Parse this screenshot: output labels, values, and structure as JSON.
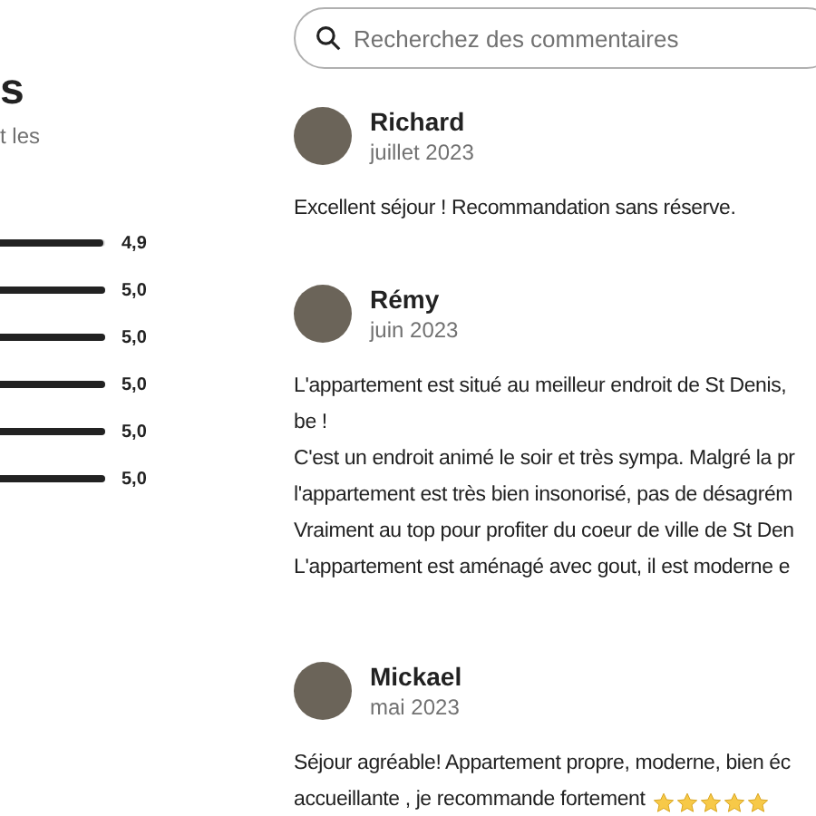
{
  "summary": {
    "heading": "s",
    "subtitle": "t les",
    "ratings": [
      {
        "level": 0.98,
        "value": "4,9"
      },
      {
        "level": 1,
        "value": "5,0"
      },
      {
        "level": 1,
        "value": "5,0"
      },
      {
        "level": 1,
        "value": "5,0"
      },
      {
        "level": 1,
        "value": "5,0"
      },
      {
        "level": 1,
        "value": "5,0"
      }
    ]
  },
  "search": {
    "placeholder": "Recherchez des commentaires"
  },
  "reviews": [
    {
      "name": "Richard",
      "date": "juillet 2023",
      "lines": [
        "Excellent séjour ! Recommandation sans réserve."
      ]
    },
    {
      "name": "Rémy",
      "date": "juin 2023",
      "lines": [
        "L'appartement est situé au meilleur endroit de St Denis,",
        "be !",
        "C'est un endroit animé le soir et très sympa. Malgré la pr",
        "l'appartement est très bien insonorisé, pas de désagrém",
        "Vraiment au top pour profiter du coeur de ville de St Den",
        "L'appartement est aménagé avec gout, il est moderne e"
      ]
    },
    {
      "name": "Mickael",
      "date": "mai 2023",
      "lines": [
        "Séjour agréable! Appartement propre, moderne, bien éc",
        "accueillante , je recommande fortement"
      ],
      "stars": 5
    }
  ]
}
